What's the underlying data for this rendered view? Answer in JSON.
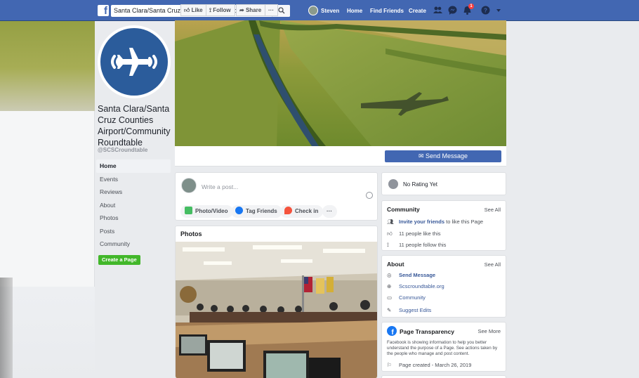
{
  "header": {
    "search_value": "Santa Clara/Santa Cruz Counties Airport/Community Round...",
    "user_name": "Steven",
    "nav": [
      "Home",
      "Find Friends",
      "Create"
    ],
    "notification_count": "1"
  },
  "page": {
    "name": "Santa Clara/Santa Cruz Counties Airport/Community Roundtable",
    "handle": "@SCSCroundtable"
  },
  "left_nav": [
    "Home",
    "Events",
    "Reviews",
    "About",
    "Photos",
    "Posts",
    "Community"
  ],
  "create_page_label": "Create a Page",
  "actions": {
    "like": "Like",
    "follow": "Follow",
    "share": "Share",
    "more": "···",
    "send_message": "Send Message"
  },
  "composer": {
    "placeholder": "Write a post...",
    "photo_video": "Photo/Video",
    "tag_friends": "Tag Friends",
    "check_in": "Check in",
    "more": "···"
  },
  "photos": {
    "title": "Photos"
  },
  "rating": {
    "text": "No Rating Yet"
  },
  "community": {
    "title": "Community",
    "see_all": "See All",
    "invite_link": "Invite your friends",
    "invite_rest": "to like this Page",
    "likes": "11 people like this",
    "follows": "11 people follow this"
  },
  "about": {
    "title": "About",
    "see_all": "See All",
    "send_message": "Send Message",
    "website": "Scscroundtable.org",
    "category": "Community",
    "suggest": "Suggest Edits"
  },
  "transparency": {
    "title": "Page Transparency",
    "see_more": "See More",
    "description": "Facebook is showing information to help you better understand the purpose of a Page. See actions taken by the people who manage and post content.",
    "created": "Page created - March 26, 2019"
  },
  "colors": {
    "brand_blue": "#4267b2",
    "link_blue": "#385898",
    "create_green": "#42b72a",
    "notification_red": "#fa3e3e"
  }
}
